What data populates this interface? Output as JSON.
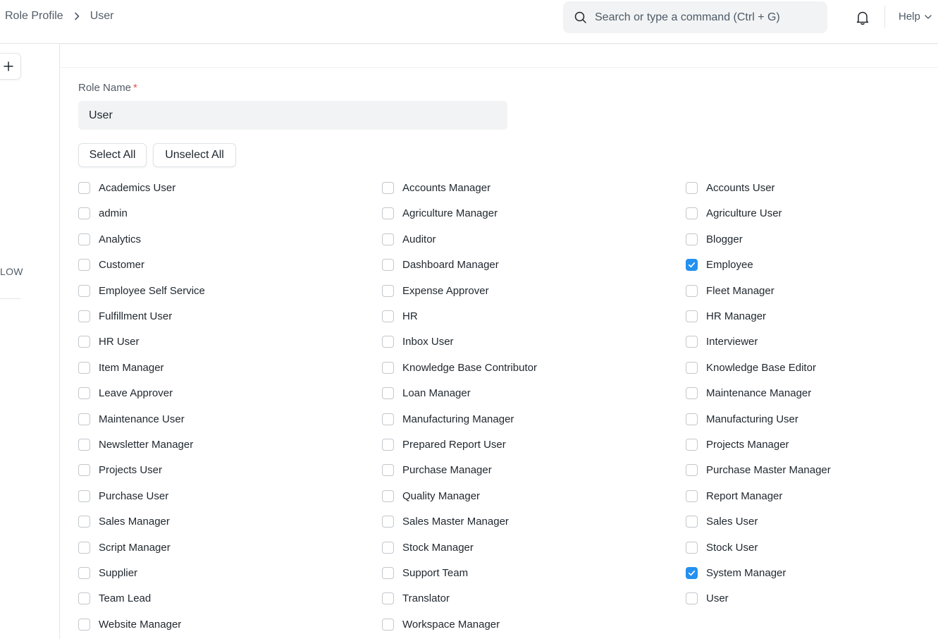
{
  "breadcrumb": {
    "items": [
      "Role Profile",
      "User"
    ]
  },
  "search": {
    "placeholder": "Search or type a command (Ctrl + G)"
  },
  "header": {
    "help_label": "Help"
  },
  "sidebar": {
    "label": "LOW"
  },
  "form": {
    "role_name_label": "Role Name",
    "required_mark": "*",
    "role_name_value": "User",
    "select_all_label": "Select All",
    "unselect_all_label": "Unselect All"
  },
  "colors": {
    "accent": "#2490ef",
    "required": "#e24c4c"
  },
  "roles": [
    [
      {
        "label": "Academics User",
        "checked": false
      },
      {
        "label": "admin",
        "checked": false
      },
      {
        "label": "Analytics",
        "checked": false
      },
      {
        "label": "Customer",
        "checked": false
      },
      {
        "label": "Employee Self Service",
        "checked": false
      },
      {
        "label": "Fulfillment User",
        "checked": false
      },
      {
        "label": "HR User",
        "checked": false
      },
      {
        "label": "Item Manager",
        "checked": false
      },
      {
        "label": "Leave Approver",
        "checked": false
      },
      {
        "label": "Maintenance User",
        "checked": false
      },
      {
        "label": "Newsletter Manager",
        "checked": false
      },
      {
        "label": "Projects User",
        "checked": false
      },
      {
        "label": "Purchase User",
        "checked": false
      },
      {
        "label": "Sales Manager",
        "checked": false
      },
      {
        "label": "Script Manager",
        "checked": false
      },
      {
        "label": "Supplier",
        "checked": false
      },
      {
        "label": "Team Lead",
        "checked": false
      },
      {
        "label": "Website Manager",
        "checked": false
      }
    ],
    [
      {
        "label": "Accounts Manager",
        "checked": false
      },
      {
        "label": "Agriculture Manager",
        "checked": false
      },
      {
        "label": "Auditor",
        "checked": false
      },
      {
        "label": "Dashboard Manager",
        "checked": false
      },
      {
        "label": "Expense Approver",
        "checked": false
      },
      {
        "label": "HR",
        "checked": false
      },
      {
        "label": "Inbox User",
        "checked": false
      },
      {
        "label": "Knowledge Base Contributor",
        "checked": false
      },
      {
        "label": "Loan Manager",
        "checked": false
      },
      {
        "label": "Manufacturing Manager",
        "checked": false
      },
      {
        "label": "Prepared Report User",
        "checked": false
      },
      {
        "label": "Purchase Manager",
        "checked": false
      },
      {
        "label": "Quality Manager",
        "checked": false
      },
      {
        "label": "Sales Master Manager",
        "checked": false
      },
      {
        "label": "Stock Manager",
        "checked": false
      },
      {
        "label": "Support Team",
        "checked": false
      },
      {
        "label": "Translator",
        "checked": false
      },
      {
        "label": "Workspace Manager",
        "checked": false
      }
    ],
    [
      {
        "label": "Accounts User",
        "checked": false
      },
      {
        "label": "Agriculture User",
        "checked": false
      },
      {
        "label": "Blogger",
        "checked": false
      },
      {
        "label": "Employee",
        "checked": true
      },
      {
        "label": "Fleet Manager",
        "checked": false
      },
      {
        "label": "HR Manager",
        "checked": false
      },
      {
        "label": "Interviewer",
        "checked": false
      },
      {
        "label": "Knowledge Base Editor",
        "checked": false
      },
      {
        "label": "Maintenance Manager",
        "checked": false
      },
      {
        "label": "Manufacturing User",
        "checked": false
      },
      {
        "label": "Projects Manager",
        "checked": false
      },
      {
        "label": "Purchase Master Manager",
        "checked": false
      },
      {
        "label": "Report Manager",
        "checked": false
      },
      {
        "label": "Sales User",
        "checked": false
      },
      {
        "label": "Stock User",
        "checked": false
      },
      {
        "label": "System Manager",
        "checked": true
      },
      {
        "label": "User",
        "checked": false
      }
    ]
  ]
}
